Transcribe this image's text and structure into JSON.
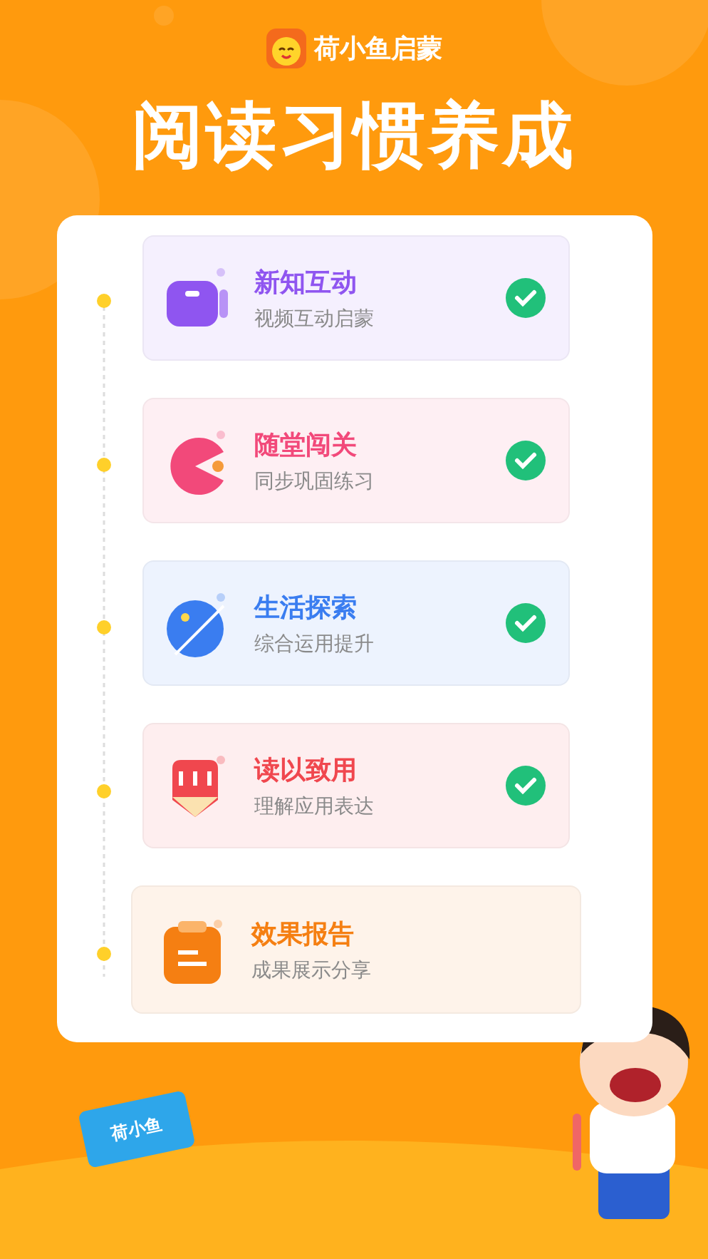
{
  "brand": {
    "name": "荷小鱼启蒙"
  },
  "headline": "阅读习惯养成",
  "steps": [
    {
      "title": "新知互动",
      "subtitle": "视频互动启蒙",
      "done": true,
      "active": false,
      "kind": "video",
      "color": "#8f55f0"
    },
    {
      "title": "随堂闯关",
      "subtitle": "同步巩固练习",
      "done": true,
      "active": false,
      "kind": "game",
      "color": "#f2497a"
    },
    {
      "title": "生活探索",
      "subtitle": "综合运用提升",
      "done": true,
      "active": false,
      "kind": "planet",
      "color": "#3a7df0"
    },
    {
      "title": "读以致用",
      "subtitle": "理解应用表达",
      "done": true,
      "active": false,
      "kind": "pencil",
      "color": "#f0474e"
    },
    {
      "title": "效果报告",
      "subtitle": "成果展示分享",
      "done": false,
      "active": true,
      "kind": "report",
      "color": "#f57f12"
    }
  ],
  "book": {
    "label": "荷小鱼"
  }
}
